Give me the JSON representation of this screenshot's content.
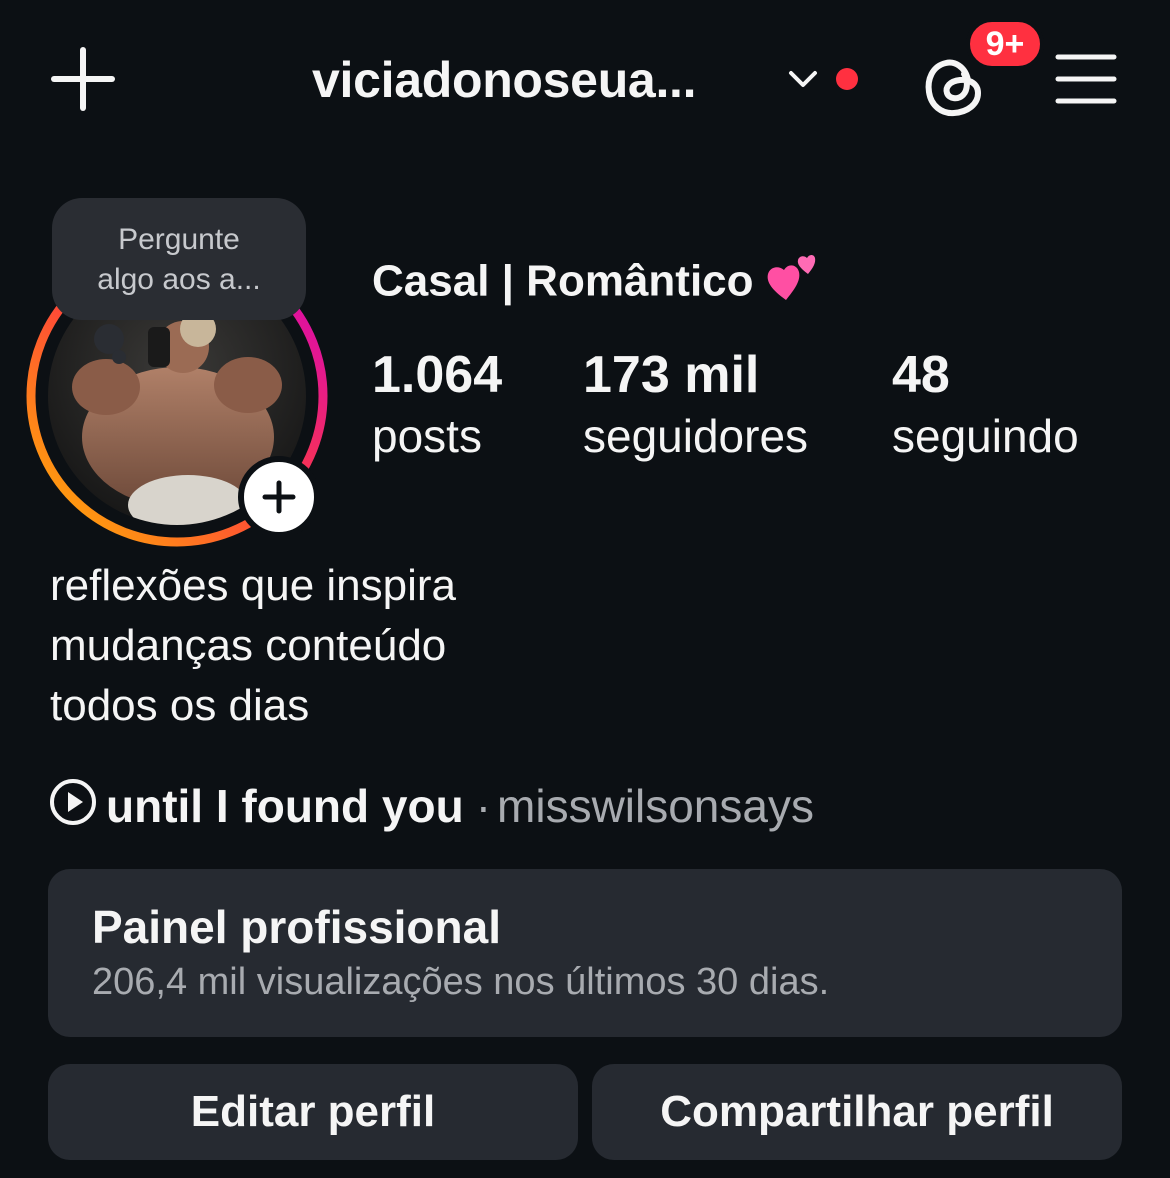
{
  "header": {
    "username": "viciadonoseua...",
    "notifications_badge": "9+"
  },
  "note": {
    "line1": "Pergunte",
    "line2": "algo aos a..."
  },
  "profile": {
    "display_name": "Casal | Romântico",
    "name_emoji": "two-hearts-icon",
    "stats": {
      "posts_count": "1.064",
      "posts_label": "posts",
      "followers_count": "173 mil",
      "followers_label": "seguidores",
      "following_count": "48",
      "following_label": "seguindo"
    },
    "bio": [
      "reflexões que inspira",
      "mudanças conteúdo",
      "todos os dias"
    ],
    "music": {
      "title": "until I found you",
      "separator": "·",
      "artist": "misswilsonsays"
    }
  },
  "dashboard": {
    "title": "Painel profissional",
    "subtitle": "206,4 mil visualizações nos últimos 30 dias."
  },
  "actions": {
    "edit_label": "Editar perfil",
    "share_label": "Compartilhar perfil"
  },
  "colors": {
    "background": "#0c1014",
    "card": "#262a31",
    "badge": "#ff3040",
    "live_dot": "#ff3040",
    "muted_text": "#a8abb0",
    "story_ring_start": "#ffb800",
    "story_ring_mid": "#ff3d3d",
    "story_ring_end": "#d300c5"
  }
}
